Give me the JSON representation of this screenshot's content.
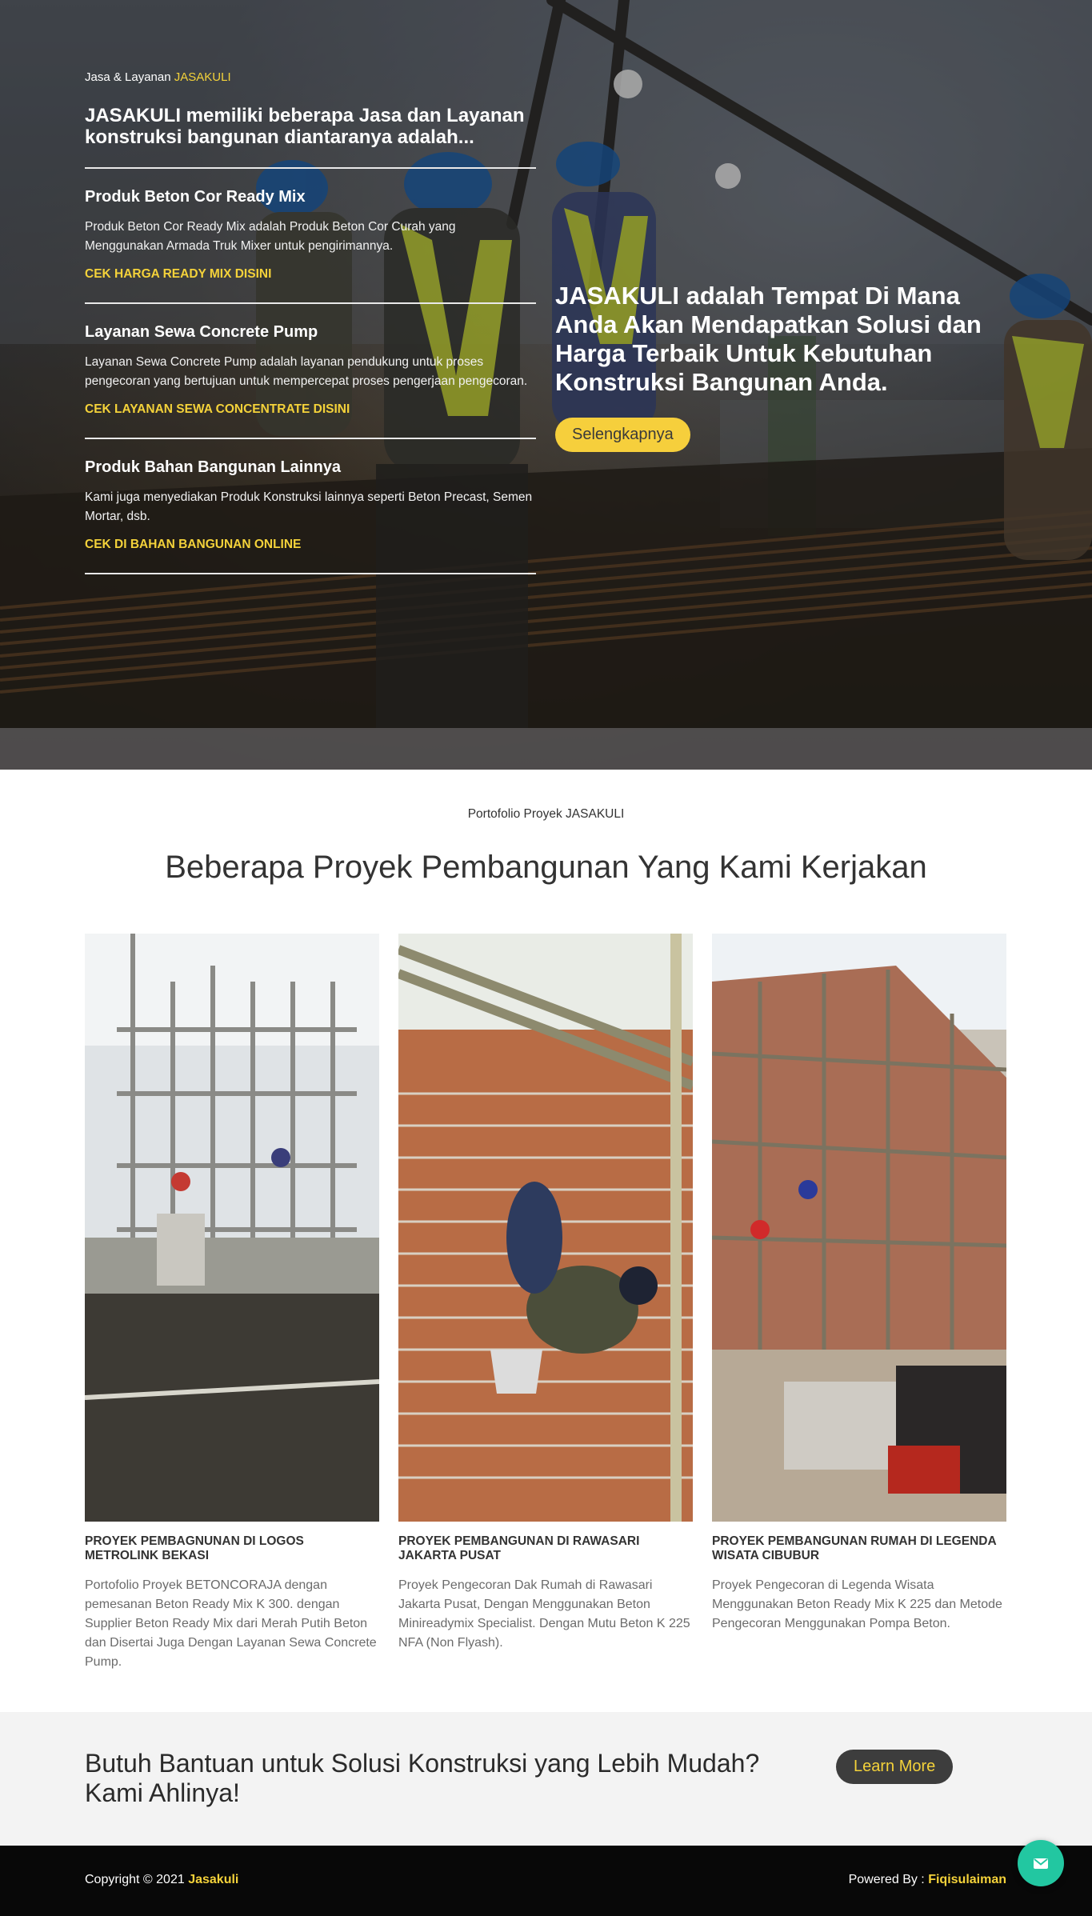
{
  "hero": {
    "eyebrow_prefix": "Jasa & Layanan ",
    "eyebrow_brand": "JASAKULI",
    "services_heading": "JASAKULI memiliki beberapa Jasa dan Layanan konstruksi bangunan diantaranya adalah...",
    "services": [
      {
        "title": "Produk Beton Cor Ready Mix",
        "description": "Produk Beton Cor Ready Mix adalah Produk Beton Cor Curah yang Menggunakan Armada Truk Mixer untuk pengirimannya.",
        "link": "CEK HARGA READY MIX DISINI"
      },
      {
        "title": "Layanan Sewa Concrete Pump",
        "description": "Layanan Sewa Concrete Pump adalah layanan pendukung untuk proses pengecoran yang bertujuan untuk mempercepat proses pengerjaan pengecoran.",
        "link": "CEK LAYANAN SEWA CONCENTRATE DISINI"
      },
      {
        "title": "Produk Bahan Bangunan Lainnya",
        "description": "Kami juga menyediakan Produk Konstruksi lainnya seperti Beton Precast, Semen Mortar, dsb.",
        "link": "CEK DI BAHAN BANGUNAN ONLINE"
      }
    ],
    "headline": "JASAKULI adalah Tempat Di Mana Anda Akan Mendapatkan Solusi dan Harga Terbaik Untuk Kebutuhan Konstruksi Bangunan Anda.",
    "cta_label": "Selengkapnya"
  },
  "portfolio": {
    "eyebrow": "Portofolio Proyek JASAKULI",
    "heading": "Beberapa Proyek Pembangunan Yang Kami Kerjakan",
    "projects": [
      {
        "title": "PROYEK PEMBAGNUNAN DI LOGOS METROLINK BEKASI",
        "description": "Portofolio Proyek BETONCORAJA dengan pemesanan Beton Ready Mix K 300. dengan Supplier Beton Ready Mix dari Merah Putih Beton dan Disertai Juga Dengan Layanan Sewa Concrete Pump."
      },
      {
        "title": "PROYEK PEMBANGUNAN DI RAWASARI JAKARTA PUSAT",
        "description": "Proyek Pengecoran Dak Rumah di Rawasari Jakarta Pusat, Dengan Menggunakan Beton Minireadymix Specialist. Dengan Mutu Beton K 225 NFA (Non Flyash)."
      },
      {
        "title": "PROYEK PEMBANGUNAN RUMAH DI LEGENDA WISATA CIBUBUR",
        "description": "Proyek Pengecoran di Legenda Wisata Menggunakan Beton Ready Mix K 225 dan Metode Pengecoran Menggunakan Pompa Beton."
      }
    ]
  },
  "cta": {
    "heading": "Butuh Bantuan untuk Solusi Konstruksi yang Lebih Mudah? Kami Ahlinya!",
    "button": "Learn More"
  },
  "footer": {
    "copyright_prefix": "Copyright © 2021 ",
    "copyright_brand": "Jasakuli",
    "powered_prefix": "Powered By : ",
    "powered_name": "Fiqisulaiman"
  },
  "colors": {
    "accent_yellow": "#f4d23a",
    "button_yellow": "#f6cf3c",
    "chat_green": "#22c7a1",
    "footer_bg": "#080808",
    "cta_bg": "#f3f3f3"
  },
  "icons": {
    "chat": "envelope-icon"
  }
}
